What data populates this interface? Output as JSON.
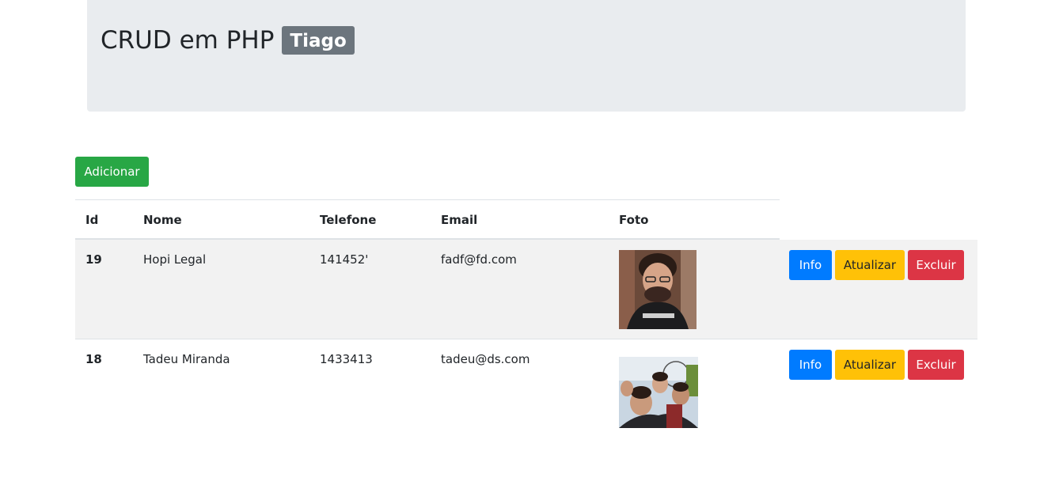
{
  "header": {
    "title": "CRUD em PHP",
    "badge": "Tiago"
  },
  "toolbar": {
    "add_label": "Adicionar"
  },
  "table": {
    "columns": [
      "Id",
      "Nome",
      "Telefone",
      "Email",
      "Foto"
    ],
    "rows": [
      {
        "id": "19",
        "nome": "Hopi Legal",
        "telefone": "141452'",
        "email": "fadf@fd.com",
        "foto": "person-photo",
        "actions": {
          "info": "Info",
          "update": "Atualizar",
          "delete": "Excluir"
        }
      },
      {
        "id": "18",
        "nome": "Tadeu Miranda",
        "telefone": "1433413",
        "email": "tadeu@ds.com",
        "foto": "group-photo",
        "actions": {
          "info": "Info",
          "update": "Atualizar",
          "delete": "Excluir"
        }
      }
    ]
  },
  "colors": {
    "jumbotron": "#e9ecef",
    "badge": "#6c757d",
    "success": "#28a745",
    "primary": "#007bff",
    "warning": "#ffc107",
    "danger": "#dc3545",
    "stripe": "#f2f2f2"
  }
}
